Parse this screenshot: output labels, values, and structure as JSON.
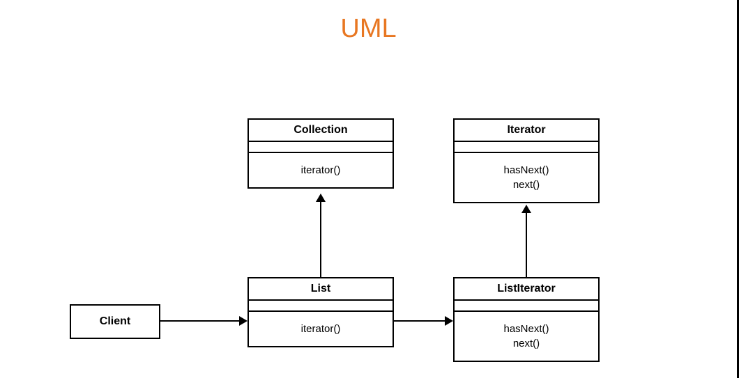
{
  "title": "UML",
  "client": {
    "label": "Client"
  },
  "boxes": {
    "collection": {
      "name": "Collection",
      "methods": [
        "iterator()"
      ]
    },
    "iterator": {
      "name": "Iterator",
      "methods": [
        "hasNext()",
        "next()"
      ]
    },
    "list": {
      "name": "List",
      "methods": [
        "iterator()"
      ]
    },
    "listIterator": {
      "name": "ListIterator",
      "methods": [
        "hasNext()",
        "next()"
      ]
    }
  }
}
